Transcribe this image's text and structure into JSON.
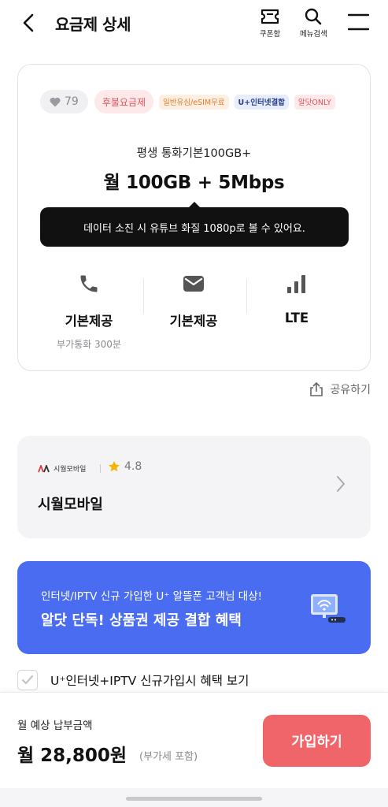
{
  "header": {
    "title": "요금제 상세",
    "coupon_label": "쿠폰함",
    "search_label": "메뉴검색"
  },
  "plan": {
    "likes": "79",
    "payment_type": "후불요금제",
    "tags": [
      "일반유심/eSIM무료",
      "U+인터넷결합",
      "알닷ONLY"
    ],
    "subtitle": "평생 통화기본100GB+",
    "main": "월 100GB + 5Mbps",
    "tooltip": "데이터 소진 시 유튜브 화질 1080p로 볼 수 있어요.",
    "features": [
      {
        "icon": "phone-icon",
        "value": "기본제공",
        "note": "부가통화 300분"
      },
      {
        "icon": "message-icon",
        "value": "기본제공",
        "note": ""
      },
      {
        "icon": "signal-icon",
        "value": "LTE",
        "note": ""
      }
    ]
  },
  "share_label": "공유하기",
  "carrier": {
    "logo_text": "시월모바일",
    "rating": "4.8",
    "name": "시월모바일"
  },
  "banner": {
    "line1": "인터넷/IPTV 신규 가입한 U⁺ 알뜰폰 고객님 대상!",
    "line2": "알닷 단독! 상품권 제공 결합 혜택"
  },
  "benefit_check_label": "U⁺인터넷+IPTV 신규가입시 혜택 보기",
  "bottom": {
    "price_label": "월 예상 납부금액",
    "price": "월 28,800원",
    "vat_note": "(부가세 포함)",
    "join_label": "가입하기"
  },
  "colors": {
    "accent_red": "#f0656a",
    "banner_blue": "#4a6cf0",
    "rating_star": "#f5b400"
  }
}
